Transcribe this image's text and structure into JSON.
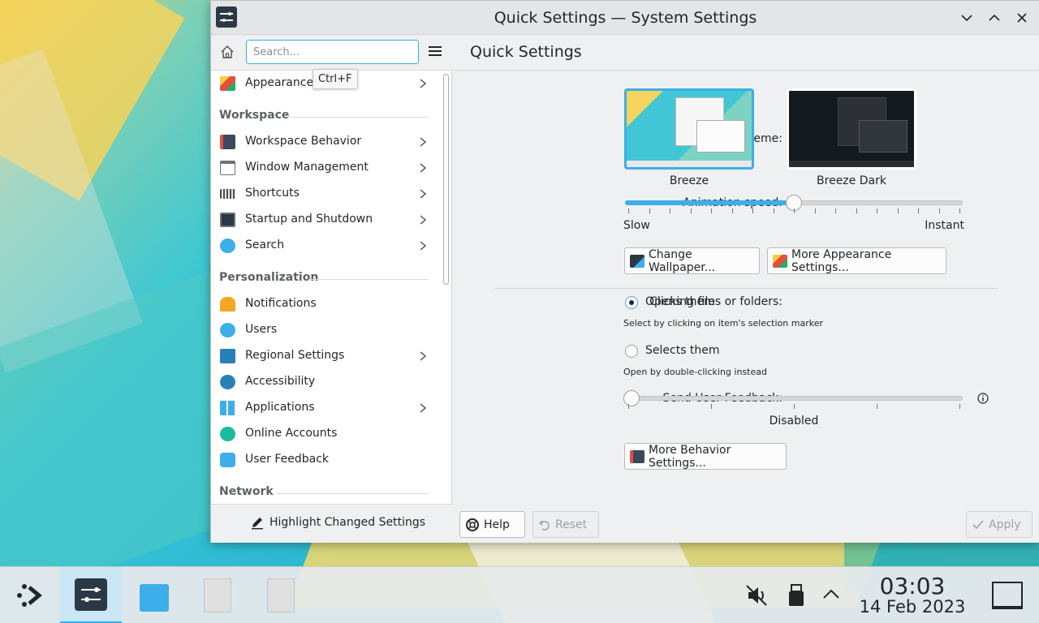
{
  "window": {
    "title": "Quick Settings — System Settings"
  },
  "sidebar": {
    "search_placeholder": "Search...",
    "tooltip": "Ctrl+F",
    "items": [
      {
        "label": "Appearance"
      },
      {
        "section": "Workspace"
      },
      {
        "label": "Workspace Behavior"
      },
      {
        "label": "Window Management"
      },
      {
        "label": "Shortcuts"
      },
      {
        "label": "Startup and Shutdown"
      },
      {
        "label": "Search"
      },
      {
        "section": "Personalization"
      },
      {
        "label": "Notifications"
      },
      {
        "label": "Users"
      },
      {
        "label": "Regional Settings"
      },
      {
        "label": "Accessibility"
      },
      {
        "label": "Applications"
      },
      {
        "label": "Online Accounts"
      },
      {
        "label": "User Feedback"
      },
      {
        "section": "Network"
      }
    ],
    "footer_button": "Highlight Changed Settings"
  },
  "main": {
    "title": "Quick Settings",
    "theme_label": "Theme:",
    "themes": [
      {
        "name": "Breeze",
        "selected": true
      },
      {
        "name": "Breeze Dark",
        "selected": false
      }
    ],
    "animation_label": "Animation speed:",
    "animation_min": "Slow",
    "animation_max": "Instant",
    "animation_value_fraction": 0.5,
    "change_wallpaper": "Change Wallpaper...",
    "more_appearance": "More Appearance Settings...",
    "clicking_label": "Clicking files or folders:",
    "opens_them": "Opens them",
    "opens_hint": "Select by clicking on item's selection marker",
    "selects_them": "Selects them",
    "selects_hint": "Open by double-clicking instead",
    "feedback_label": "Send User Feedback:",
    "feedback_value": "Disabled",
    "feedback_value_fraction": 0,
    "more_behavior": "More Behavior Settings...",
    "help": "Help",
    "reset": "Reset",
    "apply": "Apply"
  },
  "taskbar": {
    "time": "03:03",
    "date": "14 Feb 2023"
  },
  "colors": {
    "accent": "#3daee9",
    "window_bg": "#eff0f1"
  }
}
